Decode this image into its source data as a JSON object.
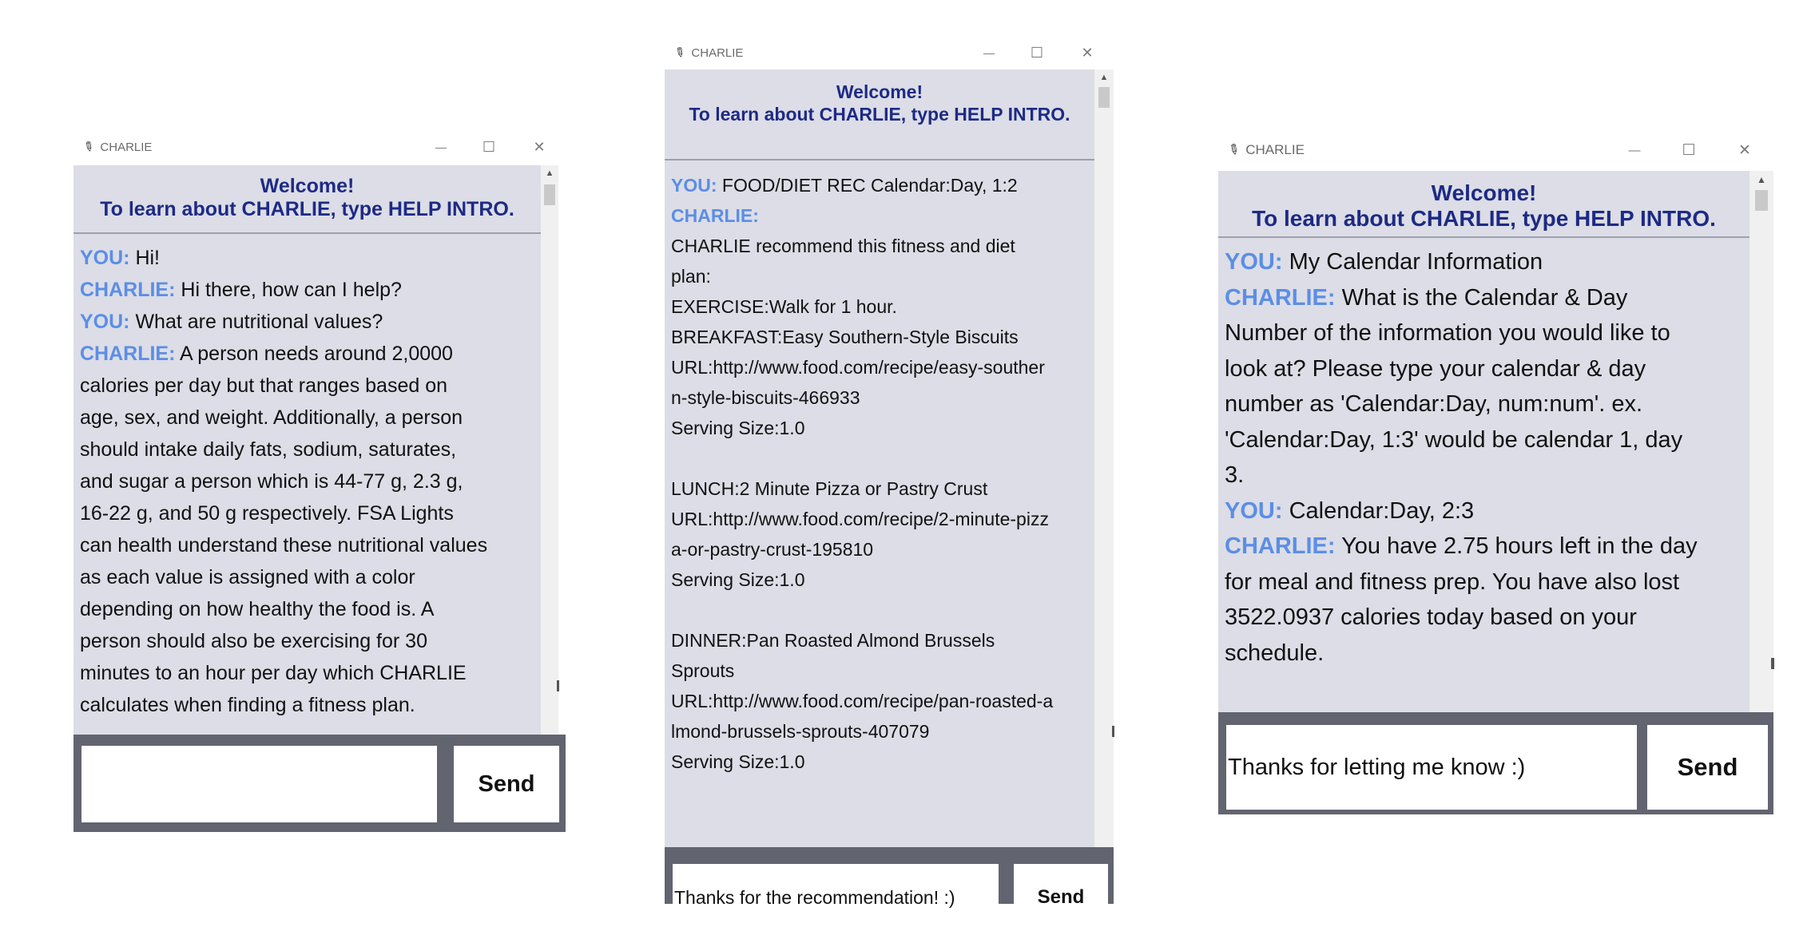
{
  "windows": [
    {
      "title": "CHARLIE",
      "header": {
        "line1": "Welcome!",
        "line2": "To learn about CHARLIE, type HELP INTRO."
      },
      "messages": [
        {
          "speaker": "YOU:",
          "lines": [
            "Hi!"
          ]
        },
        {
          "speaker": "CHARLIE:",
          "lines": [
            "Hi there, how can I help?"
          ]
        },
        {
          "speaker": "YOU:",
          "lines": [
            "What are nutritional values?"
          ]
        },
        {
          "speaker": "CHARLIE:",
          "lines": [
            "A person needs around 2,0000",
            "calories per day but that ranges based on",
            "age, sex, and weight. Additionally, a person",
            "should intake daily fats, sodium, saturates,",
            "and sugar a person which is 44-77 g, 2.3 g,",
            "16-22 g, and 50 g respectively. FSA Lights",
            "can health understand these nutritional values",
            "as each value is assigned with a color",
            "depending on how healthy the food is. A",
            "person should also be exercising for 30",
            "minutes to an hour per day which CHARLIE",
            "calculates when finding a fitness plan."
          ]
        }
      ],
      "input_value": "",
      "send_label": "Send"
    },
    {
      "title": "CHARLIE",
      "header": {
        "line1": "Welcome!",
        "line2": "To learn about CHARLIE, type HELP INTRO."
      },
      "messages": [
        {
          "speaker": "YOU:",
          "lines": [
            "FOOD/DIET REC Calendar:Day, 1:2"
          ]
        },
        {
          "speaker": "CHARLIE:",
          "lines": [
            "CHARLIE recommend this fitness and diet",
            "plan:",
            "EXERCISE:Walk for 1 hour.",
            "BREAKFAST:Easy Southern-Style Biscuits",
            "URL:http://www.food.com/recipe/easy-souther",
            "n-style-biscuits-466933",
            "Serving Size:1.0",
            "",
            "LUNCH:2 Minute Pizza or Pastry Crust",
            "URL:http://www.food.com/recipe/2-minute-pizz",
            "a-or-pastry-crust-195810",
            "Serving Size:1.0",
            "",
            "DINNER:Pan Roasted Almond Brussels",
            "Sprouts",
            "URL:http://www.food.com/recipe/pan-roasted-a",
            "lmond-brussels-sprouts-407079",
            "Serving Size:1.0"
          ]
        }
      ],
      "input_value": "Thanks for the recommendation! :)",
      "send_label": "Send"
    },
    {
      "title": "CHARLIE",
      "header": {
        "line1": "Welcome!",
        "line2": "To learn about CHARLIE, type HELP INTRO."
      },
      "messages": [
        {
          "speaker": "YOU:",
          "lines": [
            "My Calendar Information"
          ]
        },
        {
          "speaker": "CHARLIE:",
          "lines": [
            "What is the Calendar & Day",
            "Number of the information you would like to",
            "look at? Please type your calendar & day",
            "number as 'Calendar:Day, num:num'. ex.",
            "'Calendar:Day, 1:3' would be calendar 1, day",
            "3."
          ]
        },
        {
          "speaker": "YOU:",
          "lines": [
            "Calendar:Day, 2:3"
          ]
        },
        {
          "speaker": "CHARLIE:",
          "lines": [
            "You have 2.75 hours left in the day",
            "for meal and fitness prep. You have also lost",
            "3522.0937 calories today based on your",
            "schedule."
          ]
        }
      ],
      "input_value": "Thanks for letting me know :)",
      "send_label": "Send"
    }
  ],
  "icons": {
    "app_icon": "feather-icon",
    "minimize": "minimize-icon",
    "maximize": "maximize-icon",
    "close": "close-icon"
  },
  "glyphs": {
    "minimize": "—",
    "maximize": "☐",
    "close": "✕",
    "up": "▲",
    "app": "✎"
  },
  "colors": {
    "speaker": "#5b8ee6",
    "header_text": "#1d2a85",
    "chat_bg": "#dcdde6",
    "frame": "#626470"
  }
}
